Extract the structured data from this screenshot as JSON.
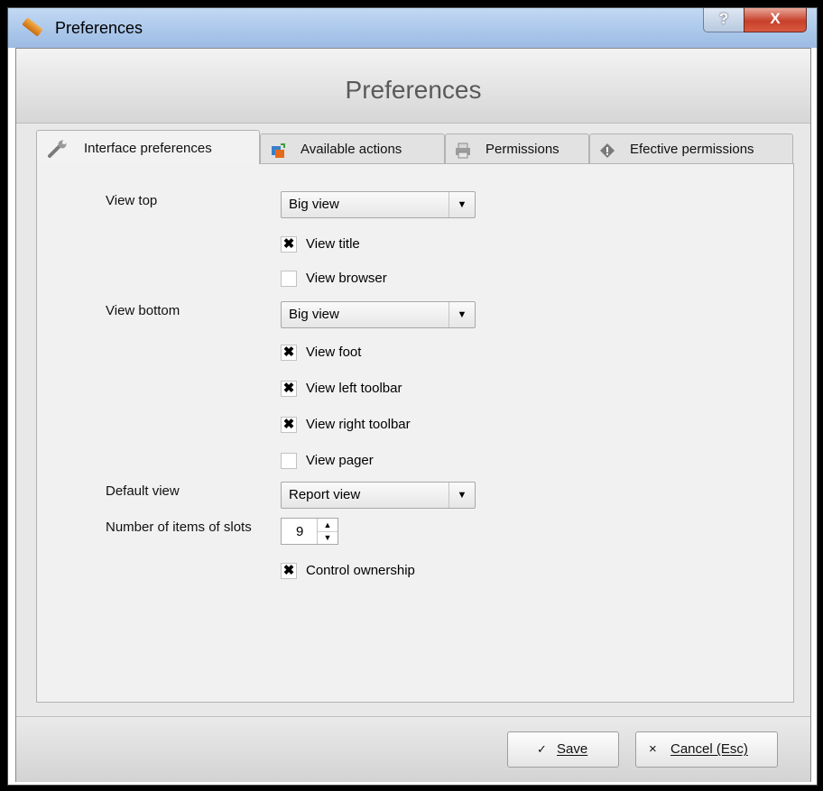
{
  "window": {
    "title": "Preferences",
    "help_label": "?",
    "close_label": "X"
  },
  "heading": "Preferences",
  "tabs": [
    {
      "label": "Interface preferences",
      "icon": "wrench-icon",
      "active": true
    },
    {
      "label": "Available actions",
      "icon": "actions-icon",
      "active": false
    },
    {
      "label": "Permissions",
      "icon": "printer-icon",
      "active": false
    },
    {
      "label": "Efective permissions",
      "icon": "diamond-icon",
      "active": false
    }
  ],
  "form": {
    "view_top_label": "View top",
    "view_top_value": "Big view",
    "view_title": {
      "label": "View title",
      "checked": true
    },
    "view_browser": {
      "label": "View browser",
      "checked": false
    },
    "view_bottom_label": "View bottom",
    "view_bottom_value": "Big view",
    "view_foot": {
      "label": "View foot",
      "checked": true
    },
    "view_left_toolbar": {
      "label": "View left toolbar",
      "checked": true
    },
    "view_right_toolbar": {
      "label": "View right toolbar",
      "checked": true
    },
    "view_pager": {
      "label": "View pager",
      "checked": false
    },
    "default_view_label": "Default view",
    "default_view_value": "Report view",
    "items_slots_label": "Number of items of slots",
    "items_slots_value": "9",
    "control_ownership": {
      "label": "Control ownership",
      "checked": true
    },
    "checked_mark": "✖"
  },
  "footer": {
    "save_label": "Save",
    "save_icon": "✓",
    "cancel_label": "Cancel (Esc)",
    "cancel_icon": "×"
  }
}
